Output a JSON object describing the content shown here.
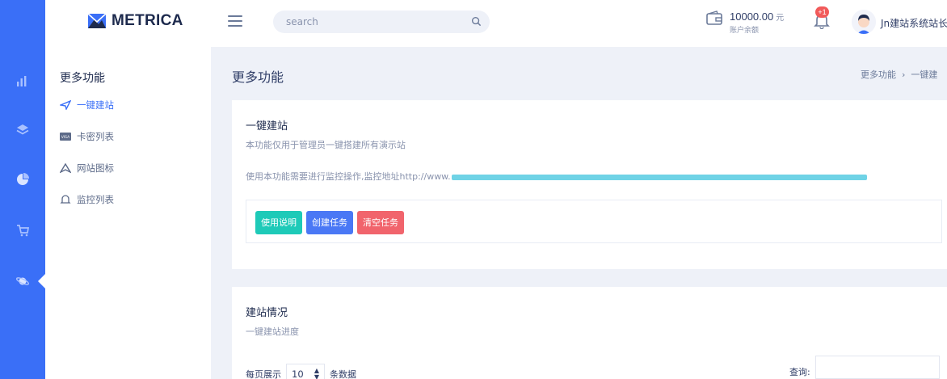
{
  "brand": {
    "name": "METRICA"
  },
  "search": {
    "placeholder": "search"
  },
  "account": {
    "balance": "10000.00",
    "unit": "元",
    "label": "账户余额"
  },
  "notifications": {
    "badge": "+1"
  },
  "user": {
    "name": "Jn建站系统站长"
  },
  "rail": {
    "items": [
      {
        "icon": "bar-chart-icon"
      },
      {
        "icon": "layers-icon"
      },
      {
        "icon": "pie-chart-icon"
      },
      {
        "icon": "cart-icon"
      },
      {
        "icon": "planet-icon",
        "active": true
      }
    ]
  },
  "subnav": {
    "title": "更多功能",
    "items": [
      {
        "label": "一键建站",
        "icon": "send-icon",
        "active": true
      },
      {
        "label": "卡密列表",
        "icon": "visa-card-icon"
      },
      {
        "label": "网站图标",
        "icon": "paper-plane-icon"
      },
      {
        "label": "监控列表",
        "icon": "bell-icon"
      }
    ]
  },
  "page": {
    "title": "更多功能",
    "breadcrumb": [
      "更多功能",
      "一键建"
    ]
  },
  "card1": {
    "title": "一键建站",
    "subtitle": "本功能仅用于管理员一键搭建所有演示站",
    "monitor_text": "使用本功能需要进行监控操作,监控地址http://www.",
    "buttons": {
      "help": "使用说明",
      "create": "创建任务",
      "clear": "清空任务"
    }
  },
  "card2": {
    "title": "建站情况",
    "subtitle": "一键建站进度",
    "perpage_prefix": "每页展示",
    "perpage_value": "10",
    "perpage_suffix": "条数据",
    "query_label": "查询:"
  },
  "colors": {
    "rail": "#3a6ff7",
    "accent": "#3a6ff7",
    "btn_help": "#1ecab8",
    "btn_create": "#4a78f5",
    "btn_clear": "#f1646c",
    "badge": "#f15a5a"
  }
}
